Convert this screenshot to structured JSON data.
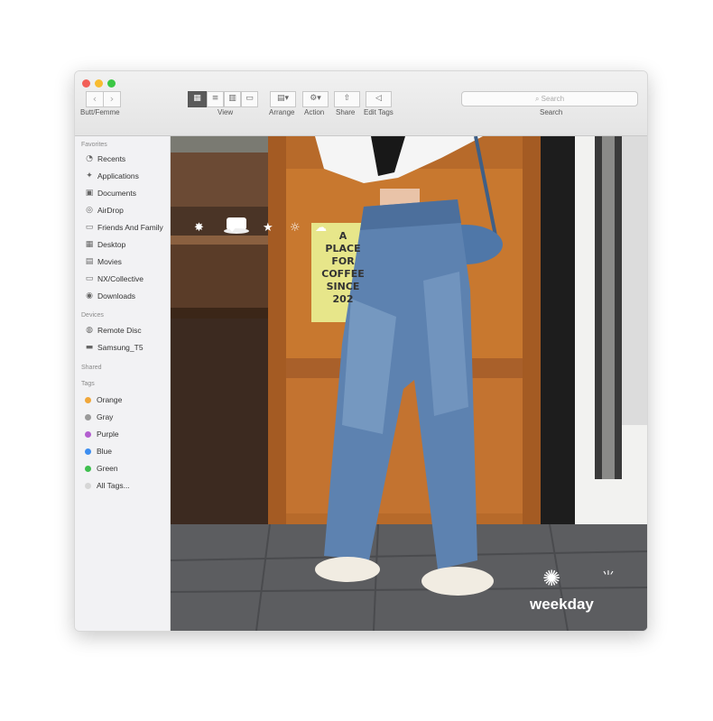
{
  "window": {
    "title": "Butt/Femme",
    "nav": {
      "back": "‹",
      "forward": "›"
    },
    "toolbar": {
      "view_label": "View",
      "arrange_label": "Arrange",
      "action_label": "Action",
      "share_label": "Share",
      "edit_tags_label": "Edit Tags",
      "search_label": "Search",
      "search_placeholder": "Search"
    }
  },
  "sidebar": {
    "favorites_header": "Favorites",
    "favorites": [
      {
        "label": "Recents",
        "icon": "clock-icon"
      },
      {
        "label": "Applications",
        "icon": "applications-icon"
      },
      {
        "label": "Documents",
        "icon": "document-icon"
      },
      {
        "label": "AirDrop",
        "icon": "airdrop-icon"
      },
      {
        "label": "Friends And Family",
        "icon": "folder-icon"
      },
      {
        "label": "Desktop",
        "icon": "desktop-icon"
      },
      {
        "label": "Movies",
        "icon": "film-icon"
      },
      {
        "label": "NX/Collective",
        "icon": "folder-icon"
      },
      {
        "label": "Downloads",
        "icon": "download-icon"
      }
    ],
    "devices_header": "Devices",
    "devices": [
      {
        "label": "Remote Disc",
        "icon": "disc-icon"
      },
      {
        "label": "Samsung_T5",
        "icon": "drive-icon"
      }
    ],
    "shared_header": "Shared",
    "tags_header": "Tags",
    "tags": [
      {
        "label": "Orange",
        "color": "#f0a73a"
      },
      {
        "label": "Gray",
        "color": "#9a9a9a"
      },
      {
        "label": "Purple",
        "color": "#b35fd0"
      },
      {
        "label": "Blue",
        "color": "#3d8ef0"
      },
      {
        "label": "Green",
        "color": "#3fbf4f"
      },
      {
        "label": "All Tags...",
        "color": "#d6d6d6"
      }
    ]
  },
  "photo": {
    "sign_lines": [
      "A",
      "PLACE",
      "FOR",
      "COFFEE",
      "SINCE",
      "202"
    ],
    "stickers": [
      "✸",
      "♥",
      "★",
      "☼",
      "☁"
    ],
    "brand": "weekday",
    "brand_icon": "sunburst-icon"
  }
}
